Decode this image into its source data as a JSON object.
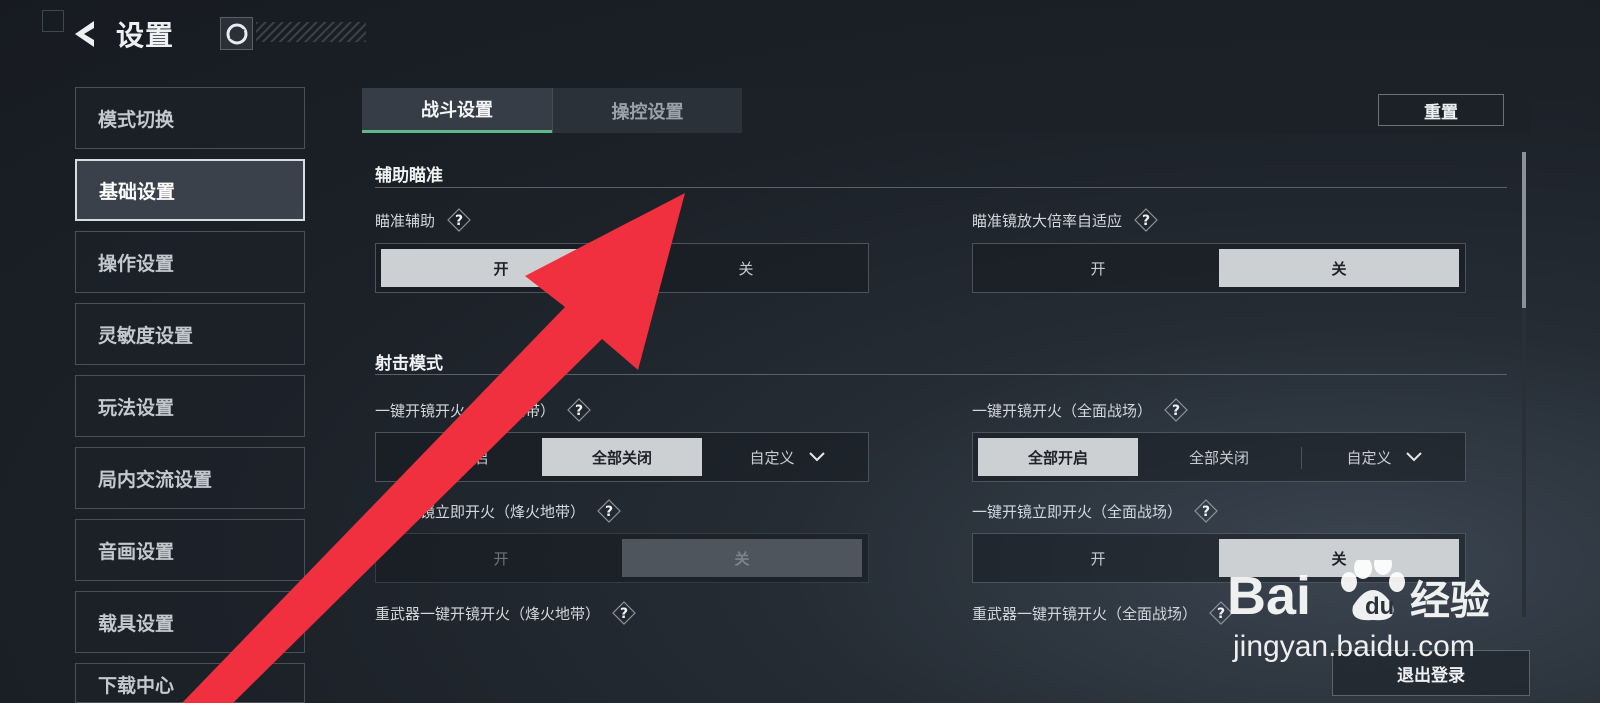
{
  "header": {
    "title": "设置",
    "back_icon": "back-chevron-icon",
    "logo_icon": "game-logo-icon"
  },
  "sidebar": {
    "items": [
      {
        "label": "模式切换",
        "active": false
      },
      {
        "label": "基础设置",
        "active": true
      },
      {
        "label": "操作设置",
        "active": false
      },
      {
        "label": "灵敏度设置",
        "active": false
      },
      {
        "label": "玩法设置",
        "active": false
      },
      {
        "label": "局内交流设置",
        "active": false
      },
      {
        "label": "音画设置",
        "active": false
      },
      {
        "label": "载具设置",
        "active": false
      },
      {
        "label": "下载中心",
        "active": false
      }
    ]
  },
  "tabs": [
    {
      "label": "战斗设置",
      "active": true
    },
    {
      "label": "操控设置",
      "active": false
    }
  ],
  "reset_label": "重置",
  "sections": {
    "aim": {
      "title": "辅助瞄准",
      "aim_assist": {
        "label": "瞄准辅助",
        "on": "开",
        "off": "关",
        "selected": "开"
      },
      "scope_adapt": {
        "label": "瞄准镜放大倍率自适应",
        "on": "开",
        "off": "关",
        "selected": "关"
      }
    },
    "fire": {
      "title": "射击模式",
      "one_key_fire_beacon": {
        "label": "一键开镜开火（烽火地带）",
        "options": [
          "全部开启",
          "全部关闭",
          "自定义"
        ],
        "selected": "全部关闭"
      },
      "one_key_fire_full": {
        "label": "一键开镜开火（全面战场）",
        "options": [
          "全部开启",
          "全部关闭",
          "自定义"
        ],
        "selected": "全部开启"
      },
      "instant_fire_beacon": {
        "label": "一键开镜立即开火（烽火地带）",
        "on": "开",
        "off": "关",
        "selected": "关",
        "disabled": true
      },
      "instant_fire_full": {
        "label": "一键开镜立即开火（全面战场）",
        "on": "开",
        "off": "关",
        "selected": "关"
      },
      "heavy_beacon": {
        "label": "重武器一键开镜开火（烽火地带）"
      },
      "heavy_full": {
        "label": "重武器一键开镜开火（全面战场）"
      }
    }
  },
  "logout_label": "退出登录",
  "help_glyph": "?",
  "watermark": {
    "brand_logo": "Baidu经验",
    "url": "jingyan.baidu.com"
  },
  "colors": {
    "accent_green": "#5fb88a",
    "selected_bg": "#cdd0d3",
    "annotation_red": "#f0303f"
  }
}
